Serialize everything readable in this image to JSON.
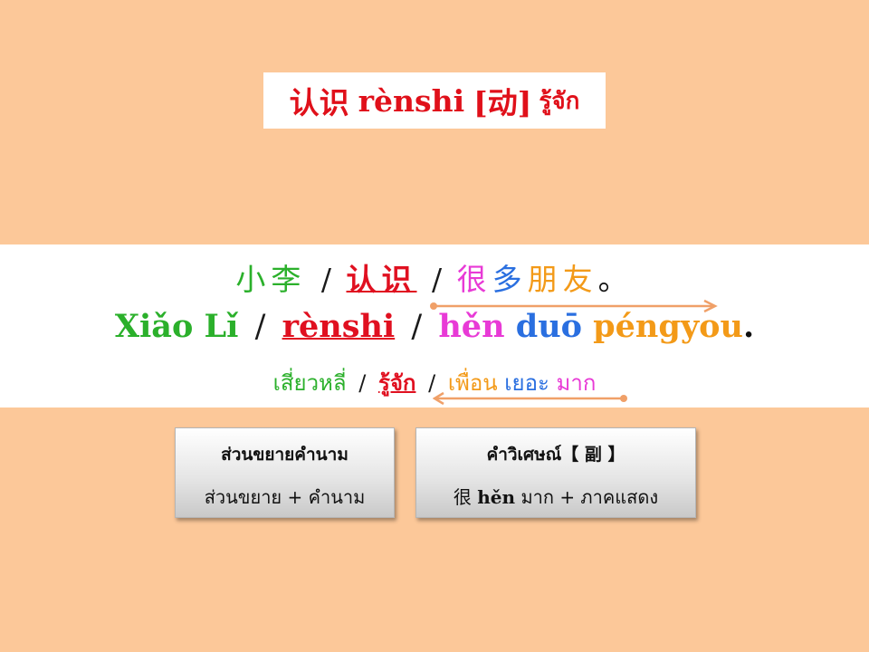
{
  "title": {
    "hanzi": "认识",
    "pinyin": "rènshi",
    "pos": "[动]",
    "thai": "รู้จัก"
  },
  "sentence": {
    "chinese": {
      "subject": "小李",
      "verb": "认识",
      "adverb": "很",
      "modifier": "多",
      "noun": "朋友",
      "period": "。"
    },
    "pinyin": {
      "subject": "Xiǎo Lǐ",
      "verb": "rènshi",
      "adverb": "hěn",
      "modifier": "duō",
      "noun": "péngyou",
      "period": "."
    },
    "thai": {
      "subject": "เสี่ยวหลี่",
      "verb": "รู้จัก",
      "noun": "เพื่อน",
      "modifier": "เยอะ",
      "adverb": "มาก"
    },
    "separator": "/"
  },
  "cards": [
    {
      "heading": "ส่วนขยายคำนาม",
      "body": "ส่วนขยาย + คำนาม"
    },
    {
      "heading": "คำวิเศษณ์【 副 】",
      "body_hanzi": "很",
      "body_pinyin": "hěn",
      "body_rest": "มาก + ภาคแสดง"
    }
  ],
  "colors": {
    "background": "#fcc899",
    "subject": "#2bb02b",
    "verb": "#e01020",
    "adverb": "#e83ad6",
    "modifier": "#2a6fe0",
    "noun": "#f39a18",
    "arrow": "#f0a068"
  }
}
